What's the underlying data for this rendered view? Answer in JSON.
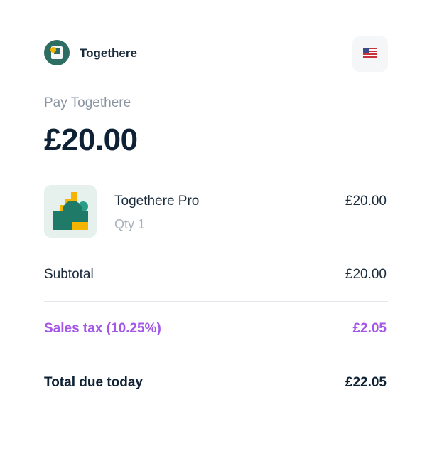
{
  "brand": {
    "name": "Togethere",
    "logo_icon": "togethere-logo-icon"
  },
  "header": {
    "language_icon": "us-flag-icon"
  },
  "payment": {
    "label": "Pay Togethere",
    "amount": "£20.00"
  },
  "item": {
    "name": "Togethere Pro",
    "quantity": "Qty 1",
    "price": "£20.00",
    "thumbnail_icon": "togethere-pro-product-icon"
  },
  "summary": {
    "subtotal_label": "Subtotal",
    "subtotal_value": "£20.00",
    "tax_label": "Sales tax (10.25%)",
    "tax_value": "£2.05",
    "total_label": "Total due today",
    "total_value": "£22.05"
  },
  "colors": {
    "brand_green": "#2e6d61",
    "accent_purple": "#a257e8",
    "text_dark": "#1a2b3c",
    "text_muted": "#8a95a3"
  }
}
